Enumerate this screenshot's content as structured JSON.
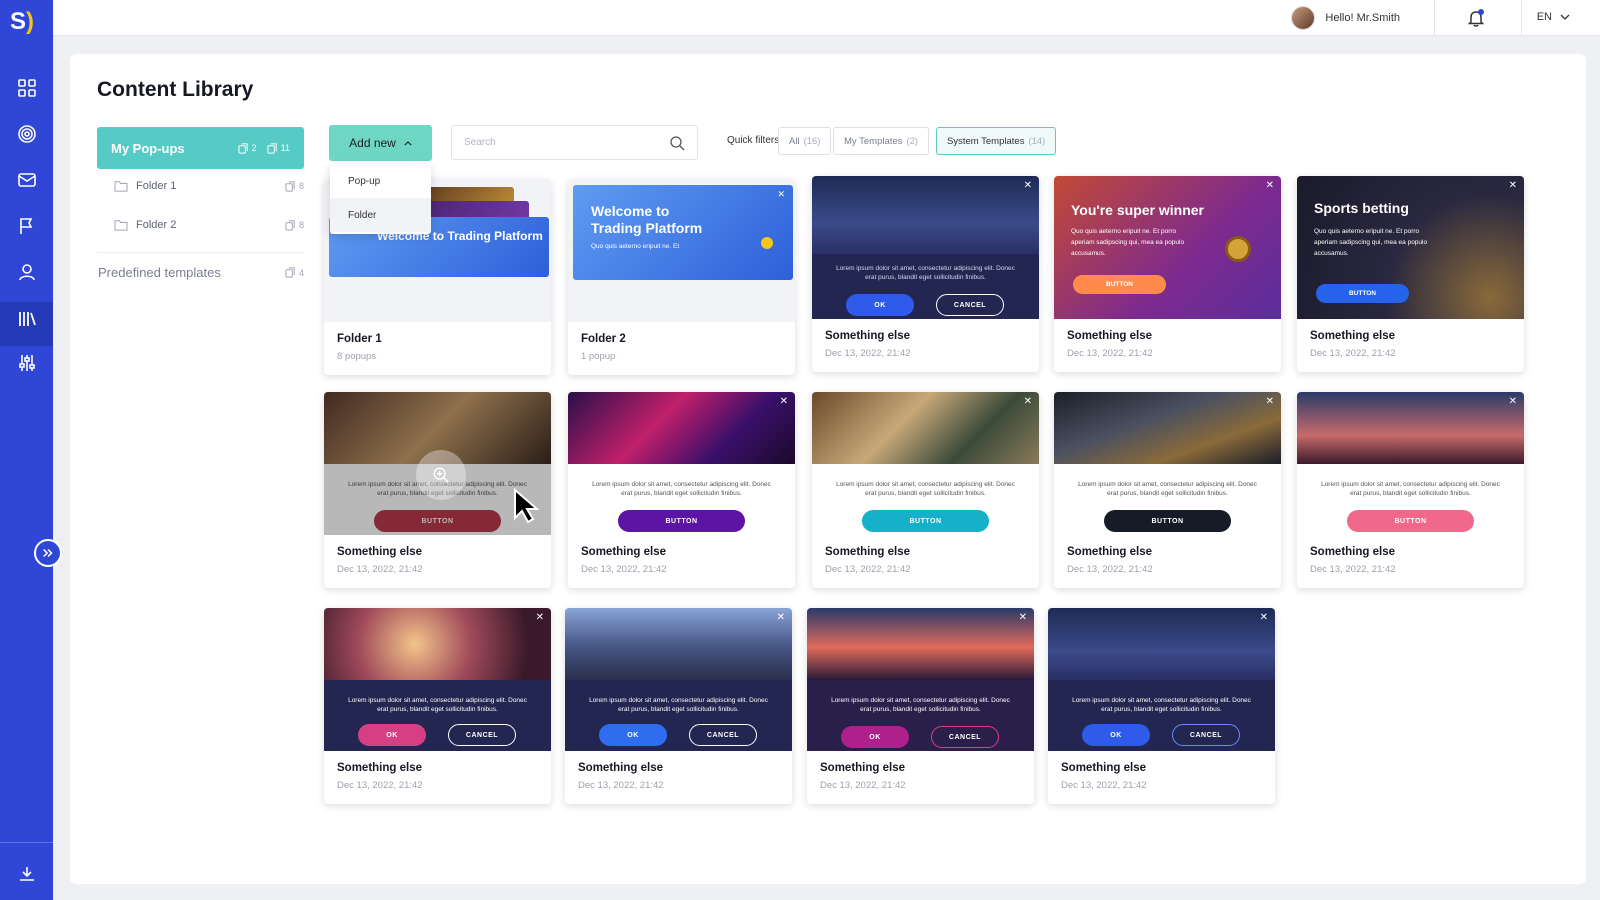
{
  "app": {
    "logo_letter": "S",
    "logo_paren": ")"
  },
  "topbar": {
    "greeting": "Hello! Mr.Smith",
    "language": "EN"
  },
  "sidebar": {
    "icons": [
      "dashboard-icon",
      "target-icon",
      "mail-icon",
      "flows-icon",
      "user-icon",
      "library-icon",
      "sliders-icon"
    ],
    "active": "library-icon"
  },
  "page": {
    "title": "Content Library"
  },
  "library_nav": {
    "active": {
      "label": "My Pop-ups",
      "count_a": "2",
      "count_b": "11"
    },
    "folders": [
      {
        "label": "Folder 1",
        "count": "8"
      },
      {
        "label": "Folder 2",
        "count": "8"
      }
    ],
    "predefined": {
      "label": "Predefined templates",
      "count": "4"
    }
  },
  "toolbar": {
    "add_new_label": "Add new",
    "dropdown": [
      "Pop-up",
      "Folder"
    ],
    "search_placeholder": "Search",
    "quick_filters_label": "Quick filters",
    "chips": [
      {
        "label": "All",
        "count": "(16)"
      },
      {
        "label": "My Templates",
        "count": "(2)"
      },
      {
        "label": "System Templates",
        "count": "(14)"
      }
    ]
  },
  "folders": [
    {
      "name": "Folder 1",
      "sub": "8 popups",
      "promo": "Welcome to Trading Platform"
    },
    {
      "name": "Folder 2",
      "sub": "1 popup",
      "promo_line1": "Welcome to",
      "promo_line2": "Trading Platform",
      "promo_text": "Quo quis aeterno eripuit ne. Et"
    }
  ],
  "lorem": "Lorem ipsum dolor sit amet, consectetur adipiscing elit. Donec erat purus, blandit eget sollicitudin finibus.",
  "promo_text": "Quo quis aeterno eripuit ne. Et porro aperiam sadipscing qui, mea ea populo accusamus.",
  "cards": [
    {
      "name": "Something else",
      "date": "Dec 13, 2022, 21:42",
      "ok": "OK",
      "cancel": "CANCEL"
    },
    {
      "name": "Something else",
      "date": "Dec 13, 2022, 21:42",
      "headline": "You're super winner",
      "button": "BUTTON"
    },
    {
      "name": "Something else",
      "date": "Dec 13, 2022, 21:42",
      "headline": "Sports betting",
      "button": "BUTTON"
    },
    {
      "name": "Something else",
      "date": "Dec 13, 2022, 21:42",
      "button": "BUTTON"
    },
    {
      "name": "Something else",
      "date": "Dec 13, 2022, 21:42",
      "button": "BUTTON"
    },
    {
      "name": "Something else",
      "date": "Dec 13, 2022, 21:42",
      "button": "BUTTON"
    },
    {
      "name": "Something else",
      "date": "Dec 13, 2022, 21:42",
      "button": "BUTTON"
    },
    {
      "name": "Something else",
      "date": "Dec 13, 2022, 21:42",
      "button": "BUTTON"
    },
    {
      "name": "Something else",
      "date": "Dec 13, 2022, 21:42",
      "ok": "OK",
      "cancel": "CANCEL"
    },
    {
      "name": "Something else",
      "date": "Dec 13, 2022, 21:42",
      "ok": "OK",
      "cancel": "CANCEL"
    },
    {
      "name": "Something else",
      "date": "Dec 13, 2022, 21:42",
      "ok": "OK",
      "cancel": "CANCEL"
    },
    {
      "name": "Something else",
      "date": "Dec 13, 2022, 21:42",
      "ok": "OK",
      "cancel": "CANCEL"
    }
  ],
  "colors": {
    "sidebar": "#2f46d6",
    "teal": "#56cbc5",
    "add_new": "#6fd6c3",
    "btn_red": "#b73a4a",
    "btn_purple": "#5b14a3",
    "btn_cyan": "#16b1c9",
    "btn_black": "#171b28",
    "btn_pink": "#f0698b",
    "btn_orange": "#ff8a4c",
    "btn_blue": "#2563eb"
  }
}
